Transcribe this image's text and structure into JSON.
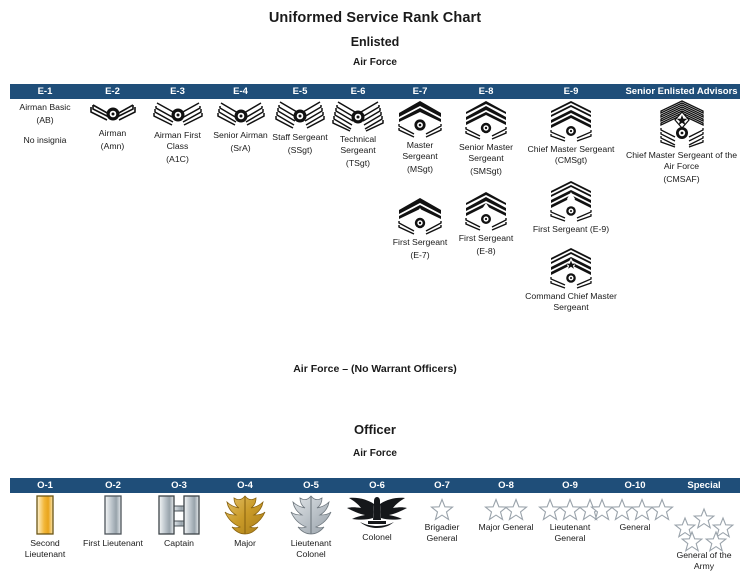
{
  "titles": {
    "main": "Uniformed Service Rank Chart",
    "enlisted": "Enlisted",
    "enlisted_branch": "Air Force",
    "warrant_note": "Air Force – (No Warrant Officers)",
    "officer": "Officer",
    "officer_branch": "Air Force"
  },
  "colors": {
    "header_bar": "#1f4e79",
    "header_text": "#ffffff",
    "body_text": "#1a1a1a",
    "gold": "#d9a321",
    "silver": "#b9bfc4",
    "insignia_dark": "#111111"
  },
  "enlisted": {
    "headers": [
      "E-1",
      "E-2",
      "E-3",
      "E-4",
      "E-5",
      "E-6",
      "E-7",
      "E-8",
      "E-9",
      "Senior Enlisted Advisors"
    ],
    "columns": [
      {
        "grade": "E-1",
        "entries": [
          {
            "icon": "no-insignia",
            "name": "Airman Basic",
            "abbr": "(AB)",
            "note": "No insignia"
          }
        ]
      },
      {
        "grade": "E-2",
        "entries": [
          {
            "icon": "chevron-1-stripe",
            "name": "Airman",
            "abbr": "(Amn)"
          }
        ]
      },
      {
        "grade": "E-3",
        "entries": [
          {
            "icon": "chevron-2-stripe",
            "name": "Airman First Class",
            "abbr": "(A1C)"
          }
        ]
      },
      {
        "grade": "E-4",
        "entries": [
          {
            "icon": "chevron-3-stripe",
            "name": "Senior Airman",
            "abbr": "(SrA)"
          }
        ]
      },
      {
        "grade": "E-5",
        "entries": [
          {
            "icon": "chevron-4-stripe",
            "name": "Staff Sergeant",
            "abbr": "(SSgt)"
          }
        ]
      },
      {
        "grade": "E-6",
        "entries": [
          {
            "icon": "chevron-5-stripe",
            "name": "Technical Sergeant",
            "abbr": "(TSgt)"
          }
        ]
      },
      {
        "grade": "E-7",
        "entries": [
          {
            "icon": "chevron-msgt",
            "name": "Master Sergeant",
            "abbr": "(MSgt)"
          },
          {
            "icon": "chevron-first-sgt-e7",
            "name": "First Sergeant",
            "abbr": "(E-7)"
          }
        ]
      },
      {
        "grade": "E-8",
        "entries": [
          {
            "icon": "chevron-smsgt",
            "name": "Senior Master Sergeant",
            "abbr": "(SMSgt)"
          },
          {
            "icon": "chevron-first-sgt-e8",
            "name": "First Sergeant",
            "abbr": "(E-8)"
          }
        ]
      },
      {
        "grade": "E-9",
        "entries": [
          {
            "icon": "chevron-cmsgt",
            "name": "Chief Master Sergeant (CMSgt)",
            "abbr": ""
          },
          {
            "icon": "chevron-first-sgt-e9",
            "name": "First Sergeant (E-9)",
            "abbr": ""
          },
          {
            "icon": "chevron-command-chief",
            "name": "Command Chief Master Sergeant",
            "abbr": ""
          }
        ]
      },
      {
        "grade": "Senior Enlisted Advisors",
        "entries": [
          {
            "icon": "chevron-cmsaf",
            "name": "Chief Master Sergeant of the Air Force",
            "abbr": "(CMSAF)"
          }
        ]
      }
    ]
  },
  "officer": {
    "headers": [
      "O-1",
      "O-2",
      "O-3",
      "O-4",
      "O-5",
      "O-6",
      "O-7",
      "O-8",
      "O-9",
      "O-10",
      "Special"
    ],
    "columns": [
      {
        "grade": "O-1",
        "icon": "gold-bar",
        "name": "Second Lieutenant"
      },
      {
        "grade": "O-2",
        "icon": "silver-bar",
        "name": "First Lieutenant"
      },
      {
        "grade": "O-3",
        "icon": "double-silver-bar",
        "name": "Captain"
      },
      {
        "grade": "O-4",
        "icon": "gold-oak-leaf",
        "name": "Major"
      },
      {
        "grade": "O-5",
        "icon": "silver-oak-leaf",
        "name": "Lieutenant Colonel"
      },
      {
        "grade": "O-6",
        "icon": "eagle",
        "name": "Colonel"
      },
      {
        "grade": "O-7",
        "icon": "one-star",
        "name": "Brigadier General"
      },
      {
        "grade": "O-8",
        "icon": "two-star",
        "name": "Major General"
      },
      {
        "grade": "O-9",
        "icon": "three-star",
        "name": "Lieutenant General"
      },
      {
        "grade": "O-10",
        "icon": "four-star",
        "name": "General"
      },
      {
        "grade": "Special",
        "icon": "five-star",
        "name": "General of the Army"
      }
    ]
  }
}
